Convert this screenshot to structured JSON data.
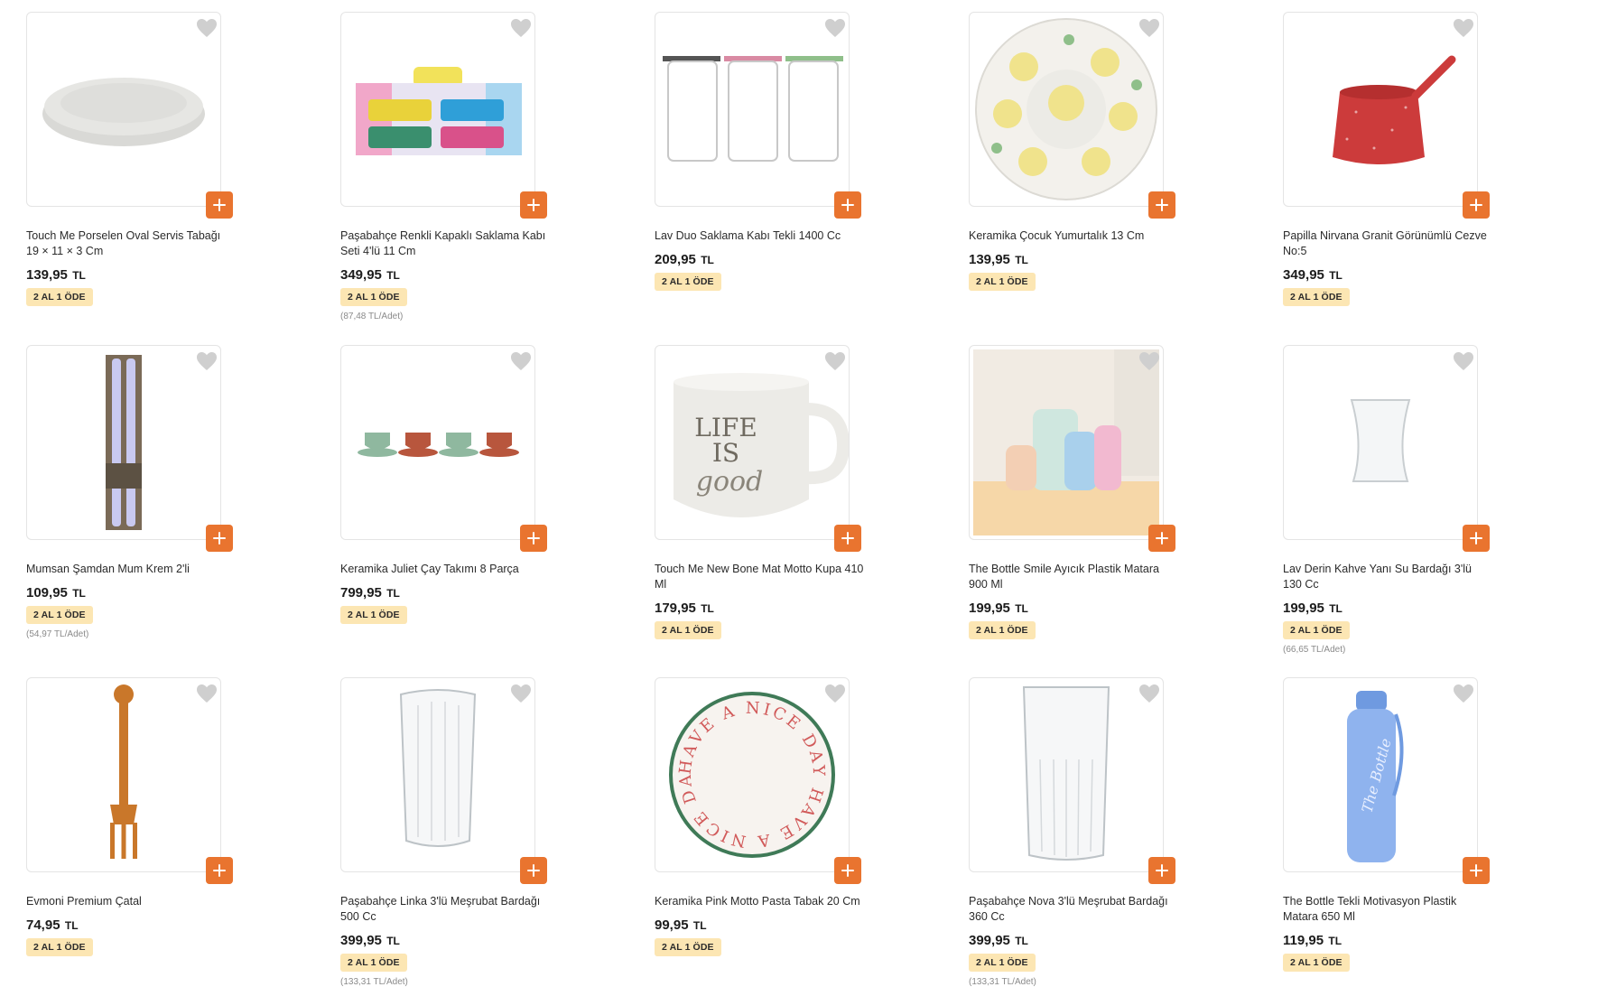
{
  "colors": {
    "accent": "#e9742f",
    "badge_bg": "#fce6b3",
    "heart": "#cfcfcf"
  },
  "products": [
    {
      "name": "Touch Me Porselen Oval Servis Tabağı 19 × 11 × 3 Cm",
      "price": "139,95",
      "currency": "TL",
      "badge": "2 AL 1 ÖDE",
      "unit_price": "",
      "image": "oval-plate"
    },
    {
      "name": "Paşabahçe Renkli Kapaklı Saklama Kabı Seti 4'lü 11 Cm",
      "price": "349,95",
      "currency": "TL",
      "badge": "2 AL 1 ÖDE",
      "unit_price": "(87,48 TL/Adet)",
      "image": "storage-box-set"
    },
    {
      "name": "Lav Duo Saklama Kabı Tekli 1400 Cc",
      "price": "209,95",
      "currency": "TL",
      "badge": "2 AL 1 ÖDE",
      "unit_price": "",
      "image": "glass-jars"
    },
    {
      "name": "Keramika Çocuk Yumurtalık 13 Cm",
      "price": "139,95",
      "currency": "TL",
      "badge": "2 AL 1 ÖDE",
      "unit_price": "",
      "image": "egg-plate"
    },
    {
      "name": "Papilla Nirvana Granit Görünümlü Cezve No:5",
      "price": "349,95",
      "currency": "TL",
      "badge": "2 AL 1 ÖDE",
      "unit_price": "",
      "image": "coffee-pot"
    },
    {
      "name": "Mumsan Şamdan Mum Krem 2'li",
      "price": "109,95",
      "currency": "TL",
      "badge": "2 AL 1 ÖDE",
      "unit_price": "(54,97 TL/Adet)",
      "image": "candles"
    },
    {
      "name": "Keramika Juliet Çay Takımı 8 Parça",
      "price": "799,95",
      "currency": "TL",
      "badge": "2 AL 1 ÖDE",
      "unit_price": "",
      "image": "tea-set"
    },
    {
      "name": "Touch Me New Bone Mat Motto Kupa 410 Ml",
      "price": "179,95",
      "currency": "TL",
      "badge": "2 AL 1 ÖDE",
      "unit_price": "",
      "image": "mug",
      "image_text": [
        "LIFE",
        "IS",
        "good"
      ]
    },
    {
      "name": "The Bottle Smile Ayıcık Plastik Matara 900 Ml",
      "price": "199,95",
      "currency": "TL",
      "badge": "2 AL 1 ÖDE",
      "unit_price": "",
      "image": "bottles-photo"
    },
    {
      "name": "Lav Derin Kahve Yanı Su Bardağı 3'lü 130 Cc",
      "price": "199,95",
      "currency": "TL",
      "badge": "2 AL 1 ÖDE",
      "unit_price": "(66,65 TL/Adet)",
      "image": "small-glass"
    },
    {
      "name": "Evmoni Premium Çatal",
      "price": "74,95",
      "currency": "TL",
      "badge": "2 AL 1 ÖDE",
      "unit_price": "",
      "image": "wooden-fork"
    },
    {
      "name": "Paşabahçe Linka 3'lü Meşrubat Bardağı 500 Cc",
      "price": "399,95",
      "currency": "TL",
      "badge": "2 AL 1 ÖDE",
      "unit_price": "(133,31 TL/Adet)",
      "image": "tall-glass"
    },
    {
      "name": "Keramika Pink Motto Pasta Tabak 20 Cm",
      "price": "99,95",
      "currency": "TL",
      "badge": "2 AL 1 ÖDE",
      "unit_price": "",
      "image": "motto-plate",
      "image_text": "HAVE A NICE DAY HAVE A NICE DAY"
    },
    {
      "name": "Paşabahçe Nova 3'lü Meşrubat Bardağı 360 Cc",
      "price": "399,95",
      "currency": "TL",
      "badge": "2 AL 1 ÖDE",
      "unit_price": "(133,31 TL/Adet)",
      "image": "ribbed-glass"
    },
    {
      "name": "The Bottle Tekli Motivasyon Plastik Matara 650 Ml",
      "price": "119,95",
      "currency": "TL",
      "badge": "2 AL 1 ÖDE",
      "unit_price": "",
      "image": "blue-bottle",
      "image_text": "The Bottle"
    }
  ]
}
